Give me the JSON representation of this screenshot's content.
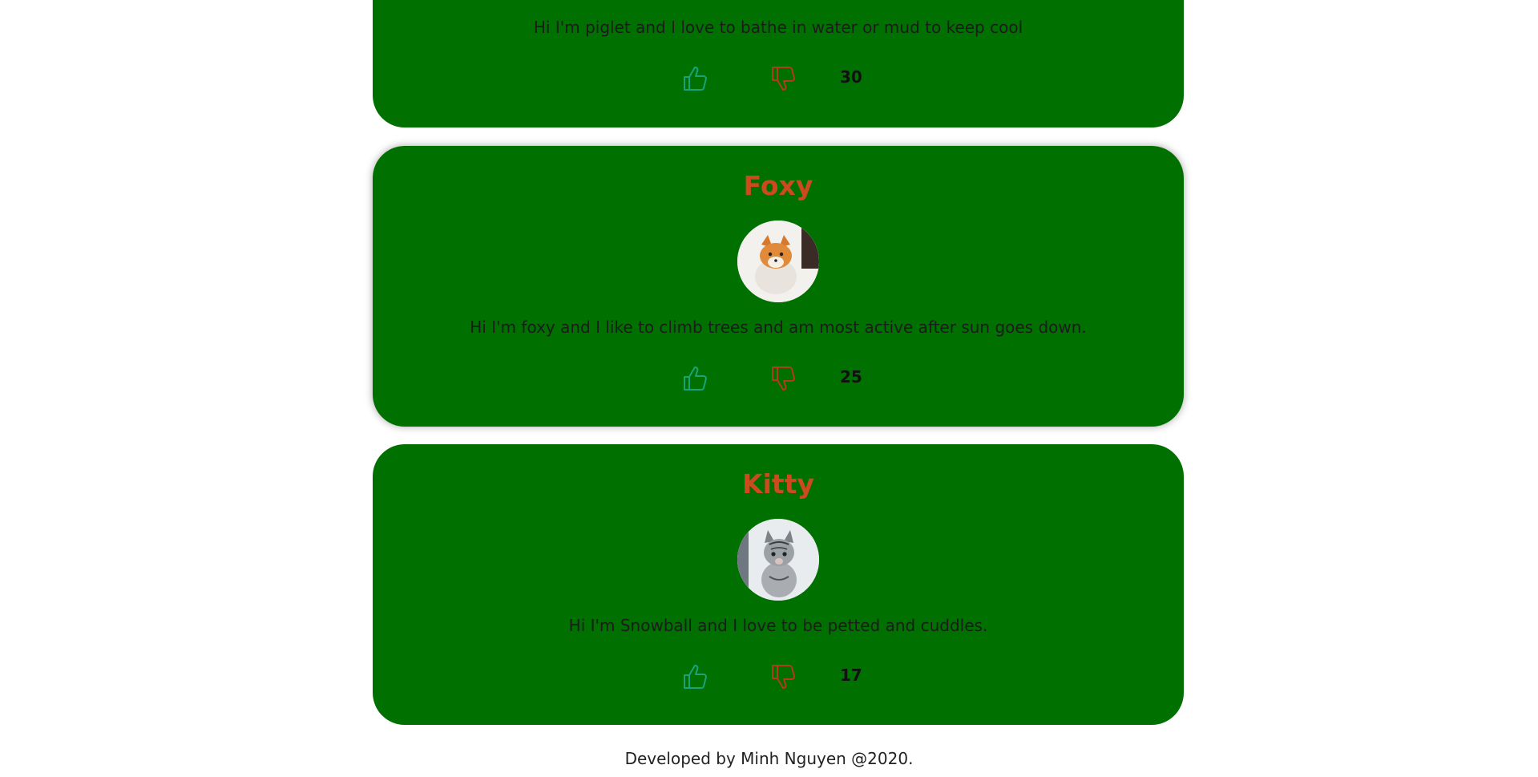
{
  "colors": {
    "card_background": "#007000",
    "name_color": "#cc4a1e",
    "like_icon_color": "#1aa37a",
    "dislike_icon_color": "#b23a1e"
  },
  "cards": [
    {
      "name": "",
      "bio": "Hi I'm piglet and I love to bathe in water or mud to keep cool",
      "count": "30"
    },
    {
      "name": "Foxy",
      "bio": "Hi I'm foxy and I like to climb trees and am most active after sun goes down.",
      "count": "25",
      "avatar_icon": "fox-photo"
    },
    {
      "name": "Kitty",
      "bio": "Hi I'm Snowball and I love to be petted and cuddles.",
      "count": "17",
      "avatar_icon": "kitten-photo"
    }
  ],
  "icons": {
    "like": "thumbs-up-icon",
    "dislike": "thumbs-down-icon"
  },
  "footer": {
    "text": "Developed by Minh Nguyen @2020."
  }
}
